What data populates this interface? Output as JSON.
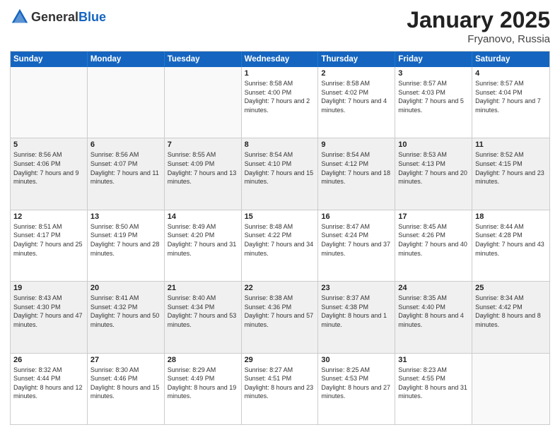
{
  "header": {
    "logo": {
      "general": "General",
      "blue": "Blue"
    },
    "title": "January 2025",
    "location": "Fryanovo, Russia"
  },
  "calendar": {
    "days": [
      "Sunday",
      "Monday",
      "Tuesday",
      "Wednesday",
      "Thursday",
      "Friday",
      "Saturday"
    ],
    "rows": [
      [
        {
          "day": "",
          "empty": true
        },
        {
          "day": "",
          "empty": true
        },
        {
          "day": "",
          "empty": true
        },
        {
          "day": "1",
          "sunrise": "8:58 AM",
          "sunset": "4:00 PM",
          "daylight": "7 hours and 2 minutes."
        },
        {
          "day": "2",
          "sunrise": "8:58 AM",
          "sunset": "4:02 PM",
          "daylight": "7 hours and 4 minutes."
        },
        {
          "day": "3",
          "sunrise": "8:57 AM",
          "sunset": "4:03 PM",
          "daylight": "7 hours and 5 minutes."
        },
        {
          "day": "4",
          "sunrise": "8:57 AM",
          "sunset": "4:04 PM",
          "daylight": "7 hours and 7 minutes."
        }
      ],
      [
        {
          "day": "5",
          "sunrise": "8:56 AM",
          "sunset": "4:06 PM",
          "daylight": "7 hours and 9 minutes.",
          "shaded": true
        },
        {
          "day": "6",
          "sunrise": "8:56 AM",
          "sunset": "4:07 PM",
          "daylight": "7 hours and 11 minutes.",
          "shaded": true
        },
        {
          "day": "7",
          "sunrise": "8:55 AM",
          "sunset": "4:09 PM",
          "daylight": "7 hours and 13 minutes.",
          "shaded": true
        },
        {
          "day": "8",
          "sunrise": "8:54 AM",
          "sunset": "4:10 PM",
          "daylight": "7 hours and 15 minutes.",
          "shaded": true
        },
        {
          "day": "9",
          "sunrise": "8:54 AM",
          "sunset": "4:12 PM",
          "daylight": "7 hours and 18 minutes.",
          "shaded": true
        },
        {
          "day": "10",
          "sunrise": "8:53 AM",
          "sunset": "4:13 PM",
          "daylight": "7 hours and 20 minutes.",
          "shaded": true
        },
        {
          "day": "11",
          "sunrise": "8:52 AM",
          "sunset": "4:15 PM",
          "daylight": "7 hours and 23 minutes.",
          "shaded": true
        }
      ],
      [
        {
          "day": "12",
          "sunrise": "8:51 AM",
          "sunset": "4:17 PM",
          "daylight": "7 hours and 25 minutes."
        },
        {
          "day": "13",
          "sunrise": "8:50 AM",
          "sunset": "4:19 PM",
          "daylight": "7 hours and 28 minutes."
        },
        {
          "day": "14",
          "sunrise": "8:49 AM",
          "sunset": "4:20 PM",
          "daylight": "7 hours and 31 minutes."
        },
        {
          "day": "15",
          "sunrise": "8:48 AM",
          "sunset": "4:22 PM",
          "daylight": "7 hours and 34 minutes."
        },
        {
          "day": "16",
          "sunrise": "8:47 AM",
          "sunset": "4:24 PM",
          "daylight": "7 hours and 37 minutes."
        },
        {
          "day": "17",
          "sunrise": "8:45 AM",
          "sunset": "4:26 PM",
          "daylight": "7 hours and 40 minutes."
        },
        {
          "day": "18",
          "sunrise": "8:44 AM",
          "sunset": "4:28 PM",
          "daylight": "7 hours and 43 minutes."
        }
      ],
      [
        {
          "day": "19",
          "sunrise": "8:43 AM",
          "sunset": "4:30 PM",
          "daylight": "7 hours and 47 minutes.",
          "shaded": true
        },
        {
          "day": "20",
          "sunrise": "8:41 AM",
          "sunset": "4:32 PM",
          "daylight": "7 hours and 50 minutes.",
          "shaded": true
        },
        {
          "day": "21",
          "sunrise": "8:40 AM",
          "sunset": "4:34 PM",
          "daylight": "7 hours and 53 minutes.",
          "shaded": true
        },
        {
          "day": "22",
          "sunrise": "8:38 AM",
          "sunset": "4:36 PM",
          "daylight": "7 hours and 57 minutes.",
          "shaded": true
        },
        {
          "day": "23",
          "sunrise": "8:37 AM",
          "sunset": "4:38 PM",
          "daylight": "8 hours and 1 minute.",
          "shaded": true
        },
        {
          "day": "24",
          "sunrise": "8:35 AM",
          "sunset": "4:40 PM",
          "daylight": "8 hours and 4 minutes.",
          "shaded": true
        },
        {
          "day": "25",
          "sunrise": "8:34 AM",
          "sunset": "4:42 PM",
          "daylight": "8 hours and 8 minutes.",
          "shaded": true
        }
      ],
      [
        {
          "day": "26",
          "sunrise": "8:32 AM",
          "sunset": "4:44 PM",
          "daylight": "8 hours and 12 minutes."
        },
        {
          "day": "27",
          "sunrise": "8:30 AM",
          "sunset": "4:46 PM",
          "daylight": "8 hours and 15 minutes."
        },
        {
          "day": "28",
          "sunrise": "8:29 AM",
          "sunset": "4:49 PM",
          "daylight": "8 hours and 19 minutes."
        },
        {
          "day": "29",
          "sunrise": "8:27 AM",
          "sunset": "4:51 PM",
          "daylight": "8 hours and 23 minutes."
        },
        {
          "day": "30",
          "sunrise": "8:25 AM",
          "sunset": "4:53 PM",
          "daylight": "8 hours and 27 minutes."
        },
        {
          "day": "31",
          "sunrise": "8:23 AM",
          "sunset": "4:55 PM",
          "daylight": "8 hours and 31 minutes."
        },
        {
          "day": "",
          "empty": true
        }
      ]
    ]
  }
}
